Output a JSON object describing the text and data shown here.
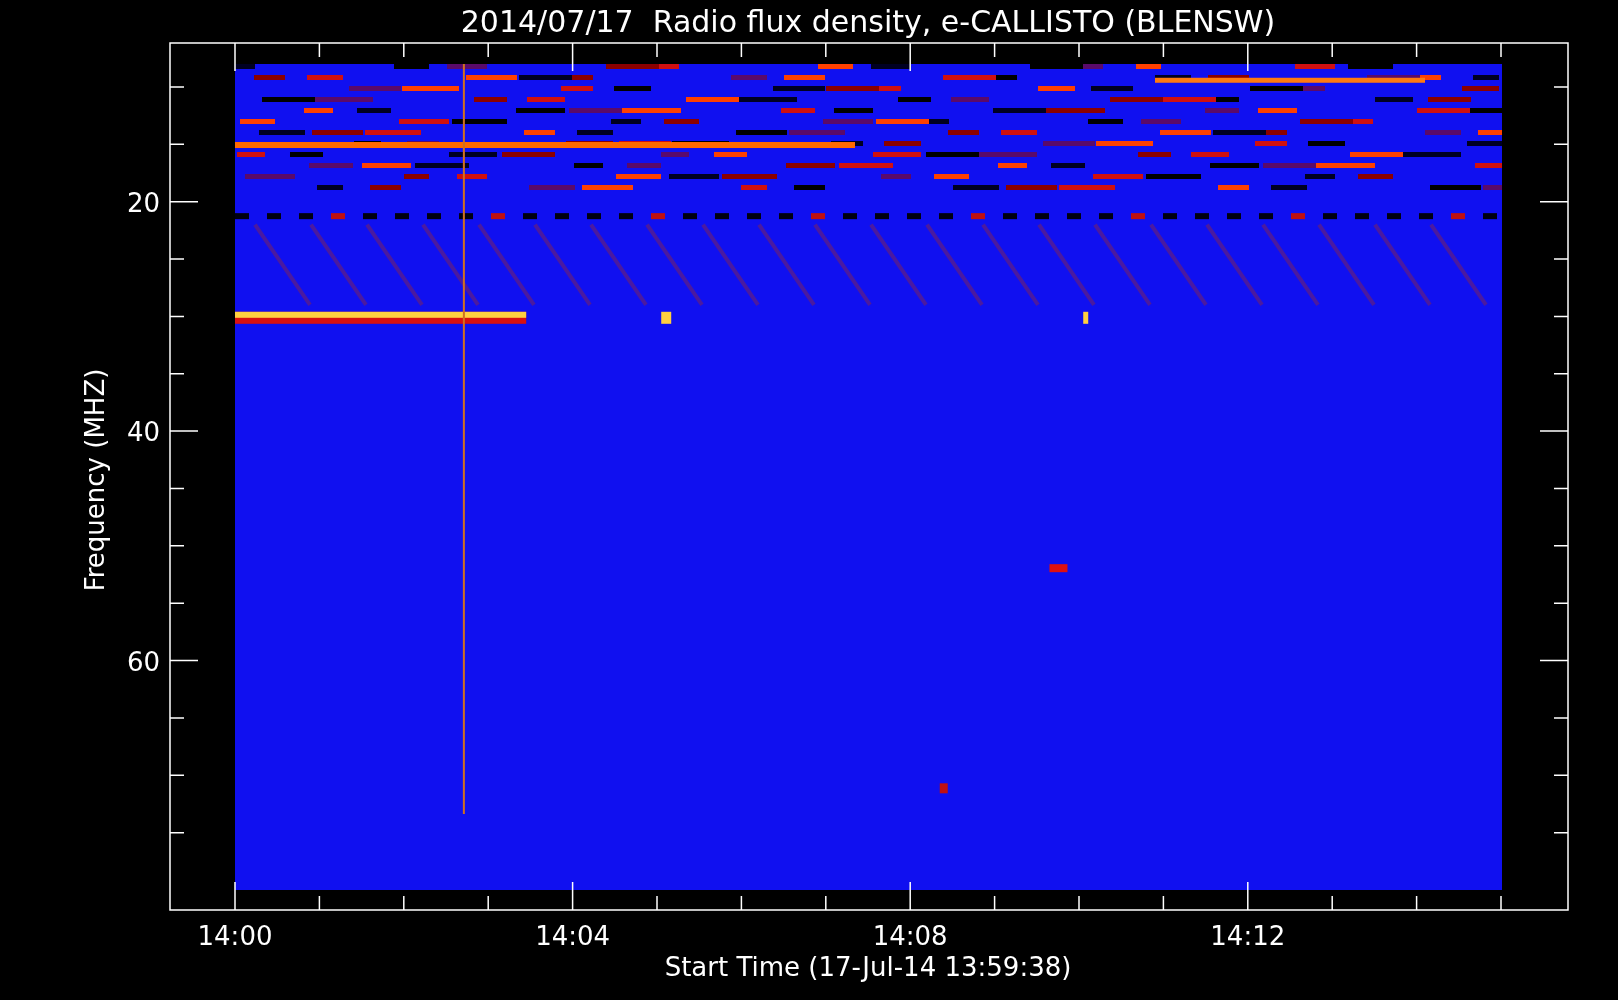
{
  "chart": {
    "title": "2014/07/17  Radio flux density, e-CALLISTO (BLENSW)",
    "ylabel": "Frequency (MHZ)",
    "xlabel": "Start Time (17-Jul-14 13:59:38)",
    "y_tick_labels": [
      "20",
      "40",
      "60"
    ],
    "x_tick_labels": [
      "14:00",
      "14:04",
      "14:08",
      "14:12"
    ]
  }
}
